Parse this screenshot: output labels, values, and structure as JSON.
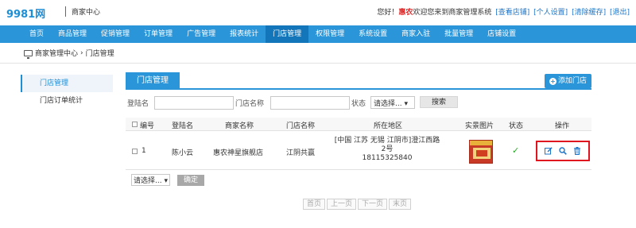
{
  "header": {
    "logo": "9981网",
    "subtitle": "商家中心",
    "welcome_prefix": "您好！",
    "username": "惠农",
    "welcome_suffix": "欢迎您来到商家管理系统",
    "links": [
      "[查看店铺]",
      "[个人设置]",
      "[清除缓存]",
      "[退出]"
    ]
  },
  "nav": {
    "items": [
      "首页",
      "商品管理",
      "促销管理",
      "订单管理",
      "广告管理",
      "报表统计",
      "门店管理",
      "权限管理",
      "系统设置",
      "商家入驻",
      "批量管理",
      "店铺设置"
    ],
    "active": "门店管理"
  },
  "breadcrumb": {
    "root": "商家管理中心",
    "separator": "›",
    "current": "门店管理"
  },
  "sidebar": {
    "items": [
      {
        "label": "门店管理",
        "active": true
      },
      {
        "label": "门店订单统计",
        "active": false
      }
    ]
  },
  "panel": {
    "title": "门店管理",
    "add_button": "添加门店"
  },
  "search": {
    "login_label": "登陆名",
    "login_value": "",
    "store_label": "门店名称",
    "store_value": "",
    "status_label": "状态",
    "status_selected": "请选择... ▾",
    "search_button": "搜索"
  },
  "table": {
    "columns": [
      "编号",
      "登陆名",
      "商家名称",
      "门店名称",
      "所在地区",
      "实景图片",
      "状态",
      "操作"
    ],
    "rows": [
      {
        "id": "1",
        "login": "陈小云",
        "merchant": "惠农神星旗舰店",
        "store": "江阴共赢",
        "region": "[中国  江苏  无锡  江阴市]澄江西路2号",
        "phone": "18115325840",
        "status": "✓"
      }
    ]
  },
  "bulk": {
    "select": "请选择... ▾",
    "confirm": "确定"
  },
  "pager": {
    "first": "首页",
    "prev": "上一页",
    "next": "下一页",
    "last": "末页"
  },
  "colors": {
    "brand": "#2a95d8",
    "nav_active": "#1476ba",
    "highlight": "#e0141e",
    "username": "#e02020"
  }
}
